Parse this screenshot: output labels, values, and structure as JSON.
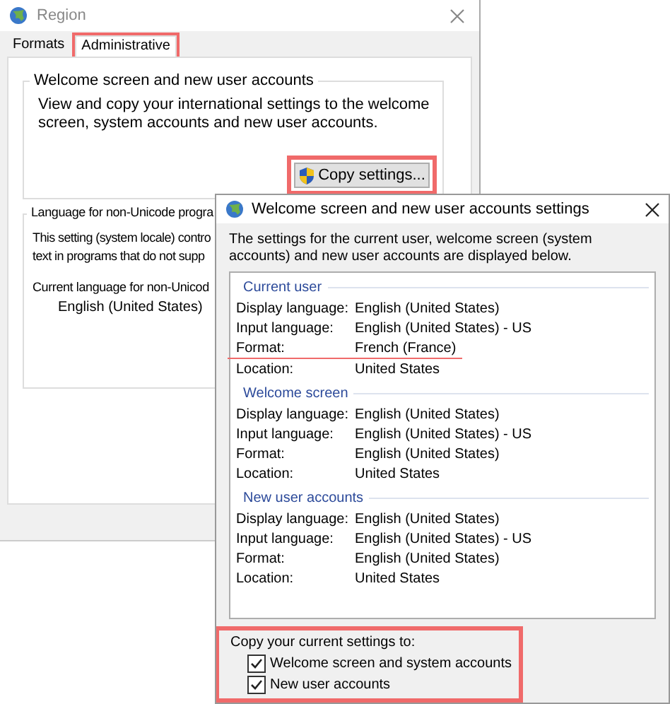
{
  "region_window": {
    "title": "Region",
    "tabs": [
      {
        "label": "Formats",
        "selected": false,
        "highlighted": false
      },
      {
        "label": "Administrative",
        "selected": true,
        "highlighted": true
      }
    ],
    "welcome_group": {
      "title": "Welcome screen and new user accounts",
      "text": "View and copy your international settings to the welcome screen, system accounts and new user accounts.",
      "button": {
        "label": "Copy settings...",
        "highlighted": true
      }
    },
    "language_group": {
      "title": "Language for non-Unicode progra",
      "text_lines": [
        "This setting (system locale) contro",
        "text in programs that do not supp"
      ],
      "current_label": "Current language for non-Unicod",
      "current_value": "English (United States)"
    }
  },
  "settings_dialog": {
    "title": "Welcome screen and new user accounts settings",
    "description": "The settings for the current user, welcome screen (system accounts) and new user accounts are displayed below.",
    "sections": [
      {
        "title": "Current user",
        "rows": [
          {
            "label": "Display language:",
            "value": "English (United States)",
            "underlined": false
          },
          {
            "label": "Input language:",
            "value": "English (United States) - US",
            "underlined": false
          },
          {
            "label": "Format:",
            "value": "French (France)",
            "underlined": true
          },
          {
            "label": "Location:",
            "value": "United States",
            "underlined": false
          }
        ]
      },
      {
        "title": "Welcome screen",
        "rows": [
          {
            "label": "Display language:",
            "value": "English (United States)",
            "underlined": false
          },
          {
            "label": "Input language:",
            "value": "English (United States) - US",
            "underlined": false
          },
          {
            "label": "Format:",
            "value": "English (United States)",
            "underlined": false
          },
          {
            "label": "Location:",
            "value": "United States",
            "underlined": false
          }
        ]
      },
      {
        "title": "New user accounts",
        "rows": [
          {
            "label": "Display language:",
            "value": "English (United States)",
            "underlined": false
          },
          {
            "label": "Input language:",
            "value": "English (United States) - US",
            "underlined": false
          },
          {
            "label": "Format:",
            "value": "English (United States)",
            "underlined": false
          },
          {
            "label": "Location:",
            "value": "United States",
            "underlined": false
          }
        ]
      }
    ],
    "copy": {
      "label": "Copy your current settings to:",
      "highlighted": true,
      "options": [
        {
          "label": "Welcome screen and system accounts",
          "checked": true
        },
        {
          "label": "New user accounts",
          "checked": true
        }
      ]
    }
  }
}
